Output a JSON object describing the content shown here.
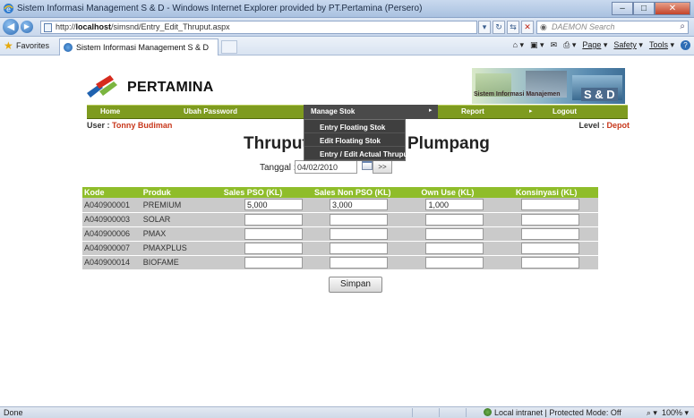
{
  "browser": {
    "window_title": "Sistem Informasi Management S & D - Windows Internet Explorer provided by PT.Pertamina (Persero)",
    "window_buttons": {
      "minimize": "–",
      "maximize": "□",
      "close": "✕"
    },
    "address_url_prefix": "http://",
    "address_url_host": "localhost",
    "address_url_path": "/simsnd/Entry_Edit_Thruput.aspx",
    "search_placeholder": "DAEMON Search",
    "favorites_label": "Favorites",
    "tab_label": "Sistem Informasi Management S & D",
    "command_bar": {
      "page": "Page",
      "safety": "Safety",
      "tools": "Tools"
    },
    "status": {
      "left": "Done",
      "zone": "Local intranet | Protected Mode: Off",
      "zoom": "100%"
    },
    "colors": {
      "chrome": "#c9d9ee",
      "close": "#c3432a"
    }
  },
  "page": {
    "logo_text": "PERTAMINA",
    "banner": {
      "text": "Sistem Informasi Manajemen",
      "badge": "S & D"
    },
    "menu": {
      "items": [
        {
          "label": "Home"
        },
        {
          "label": "Ubah Password"
        },
        {
          "label": "Manage Stok",
          "arrow": "▸"
        },
        {
          "label": "Report",
          "arrow": "▸"
        },
        {
          "label": "Logout"
        }
      ],
      "dropdown": [
        {
          "label": "Entry Floating Stok"
        },
        {
          "label": "Edit Floating Stok"
        },
        {
          "label": "Entry / Edit Actual Thruput"
        }
      ],
      "colors": {
        "bar": "#7e9b1f",
        "active": "#4a4a4a"
      }
    },
    "user_label": "User : ",
    "user_name": "Tonny Budiman",
    "level_label": "Level : ",
    "level_name": "Depot",
    "title_left": "Thruput",
    "title_right": "Plumpang",
    "tanggal_label": "Tanggal :",
    "tanggal_value": "04/02/2010",
    "go_label": ">>",
    "table": {
      "headers": [
        "Kode",
        "Produk",
        "Sales PSO (KL)",
        "Sales Non PSO (KL)",
        "Own Use (KL)",
        "Konsinyasi (KL)"
      ],
      "rows": [
        {
          "kode": "A040900001",
          "produk": "PREMIUM",
          "sales_pso": "5,000",
          "sales_non_pso": "3,000",
          "own_use": "1,000",
          "konsinyasi": ""
        },
        {
          "kode": "A040900003",
          "produk": "SOLAR",
          "sales_pso": "",
          "sales_non_pso": "",
          "own_use": "",
          "konsinyasi": ""
        },
        {
          "kode": "A040900006",
          "produk": "PMAX",
          "sales_pso": "",
          "sales_non_pso": "",
          "own_use": "",
          "konsinyasi": ""
        },
        {
          "kode": "A040900007",
          "produk": "PMAXPLUS",
          "sales_pso": "",
          "sales_non_pso": "",
          "own_use": "",
          "konsinyasi": ""
        },
        {
          "kode": "A040900014",
          "produk": "BIOFAME",
          "sales_pso": "",
          "sales_non_pso": "",
          "own_use": "",
          "konsinyasi": ""
        }
      ],
      "colors": {
        "header": "#8fbd2a",
        "row": "#cacaca"
      }
    },
    "save_label": "Simpan"
  }
}
